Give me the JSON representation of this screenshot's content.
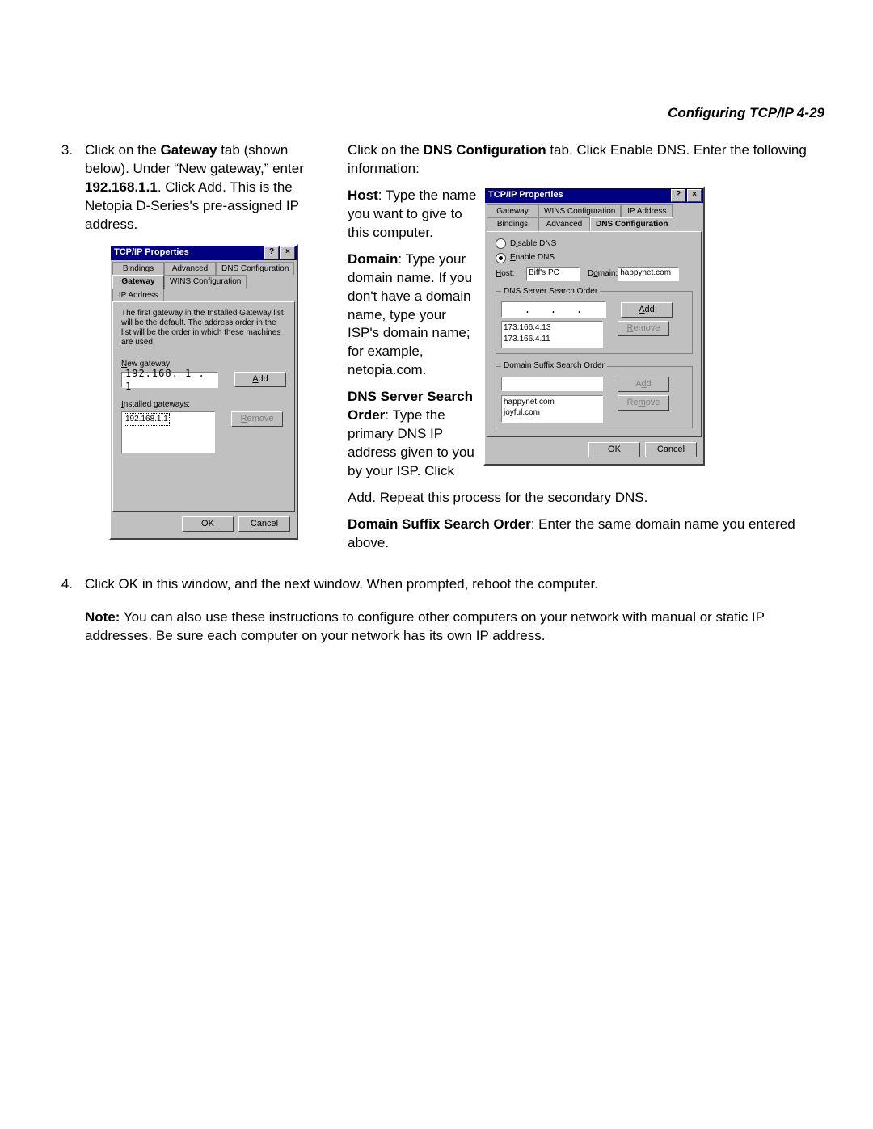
{
  "header": "Configuring TCP/IP   4-29",
  "steps": {
    "s3num": "3.",
    "s3a_pre": "Click on the ",
    "s3a_b": "Gateway",
    "s3a_post": " tab (shown below). Under “New gateway,” enter ",
    "s3a_b2": "192.168.1.1",
    "s3a_post2": ". Click Add. This is the Netopia D-Series's pre-assigned IP address.",
    "s3b_pre": "Click on the ",
    "s3b_b": "DNS Configuration",
    "s3b_post": " tab. Click Enable DNS. Enter the following information:",
    "s3_host_b": "Host",
    "s3_host": ": Type the name you want to give to this computer.",
    "s3_domain_b": "Domain",
    "s3_domain": ": Type your domain name. If you don't have a domain name, type your ISP's domain name; for example, netopia.com.",
    "s3_dnssrv_b": "DNS Server Search Order",
    "s3_dnssrv": ": Type the primary DNS IP address given to you by your ISP. Click Add. Repeat this process for the secondary DNS.",
    "s3_suffix_b": "Domain Suffix Search Order",
    "s3_suffix": ": Enter the same domain name you entered above.",
    "s4num": "4.",
    "s4": "Click OK in this window, and the next window. When prompted, reboot the computer.",
    "note_b": "Note:",
    "note": " You can also use these instructions to configure other computers on your network with manual or static IP addresses. Be sure each computer on your network has its own IP address."
  },
  "dialog1": {
    "title": "TCP/IP Properties",
    "tabs": {
      "bindings": "Bindings",
      "advanced": "Advanced",
      "dnsconf": "DNS Configuration",
      "gateway": "Gateway",
      "wins": "WINS Configuration",
      "ipaddr": "IP Address"
    },
    "info": "The first gateway in the Installed Gateway list will be the default. The address order in the list will be the order in which these machines are used.",
    "newgw_label": "New gateway:",
    "newgw_value": "192.168. 1 . 1",
    "add": "Add",
    "installed_label": "Installed gateways:",
    "installed_item": "192.168.1.1",
    "remove": "Remove",
    "ok": "OK",
    "cancel": "Cancel"
  },
  "dialog2": {
    "title": "TCP/IP Properties",
    "tabs": {
      "gateway": "Gateway",
      "wins": "WINS Configuration",
      "ipaddr": "IP Address",
      "bindings": "Bindings",
      "advanced": "Advanced",
      "dnsconf": "DNS Configuration"
    },
    "disable": "Disable DNS",
    "enable": "Enable DNS",
    "host_label": "Host:",
    "host_value": "Biff's PC",
    "domain_label": "Domain:",
    "domain_value": "happynet.com",
    "dns_search_label": "DNS Server Search Order",
    "add": "Add",
    "remove": "Remove",
    "dns1": "173.166.4.13",
    "dns2": "173.166.4.11",
    "suffix_label": "Domain Suffix Search Order",
    "suffix1": "happynet.com",
    "suffix2": "joyful.com",
    "ok": "OK",
    "cancel": "Cancel"
  }
}
